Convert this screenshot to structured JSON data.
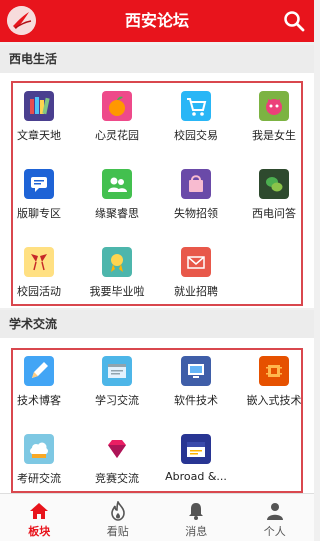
{
  "header": {
    "title": "西安论坛"
  },
  "sections": [
    {
      "title": "西电生活",
      "items": [
        {
          "label": "文章天地",
          "icon": "books-icon"
        },
        {
          "label": "心灵花园",
          "icon": "orange-fruit-icon"
        },
        {
          "label": "校园交易",
          "icon": "shopping-cart-icon"
        },
        {
          "label": "我是女生",
          "icon": "girl-face-icon"
        },
        {
          "label": "版聊专区",
          "icon": "chat-bubble-icon"
        },
        {
          "label": "缘聚睿思",
          "icon": "people-icon"
        },
        {
          "label": "失物招领",
          "icon": "shopping-bag-icon"
        },
        {
          "label": "西电问答",
          "icon": "wechat-icon"
        },
        {
          "label": "校园活动",
          "icon": "cheers-glasses-icon"
        },
        {
          "label": "我要毕业啦",
          "icon": "graduation-ribbon-icon"
        },
        {
          "label": "就业招聘",
          "icon": "envelope-icon"
        }
      ]
    },
    {
      "title": "学术交流",
      "items": [
        {
          "label": "技术博客",
          "icon": "pencil-icon"
        },
        {
          "label": "学习交流",
          "icon": "window-icon"
        },
        {
          "label": "软件技术",
          "icon": "monitor-icon"
        },
        {
          "label": "嵌入式技术",
          "icon": "chip-icon"
        },
        {
          "label": "考研交流",
          "icon": "cloud-icon"
        },
        {
          "label": "竞赛交流",
          "icon": "gem-icon"
        },
        {
          "label": "Abroad &...",
          "icon": "english-book-icon"
        }
      ]
    }
  ],
  "tabs": [
    {
      "label": "板块",
      "icon": "home-icon",
      "active": true
    },
    {
      "label": "看贴",
      "icon": "flame-icon",
      "active": false
    },
    {
      "label": "消息",
      "icon": "bell-icon",
      "active": false
    },
    {
      "label": "个人",
      "icon": "person-icon",
      "active": false
    }
  ],
  "colors": {
    "brand": "#e8141c",
    "frame": "#d9474e",
    "active_tab": "#e8141c"
  }
}
